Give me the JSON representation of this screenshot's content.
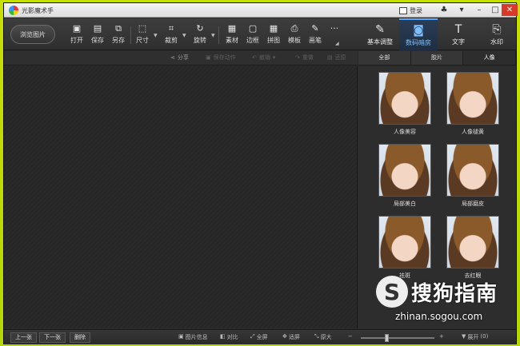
{
  "window": {
    "title": "光影魔术手"
  },
  "titlebar": {
    "login_label": "登录",
    "buttons": [
      "skin-icon",
      "menu-icon",
      "minimize-icon",
      "maximize-icon",
      "close-icon"
    ],
    "minimize": "–",
    "maximize": "□",
    "close": "✕",
    "skin": "♣",
    "menu": "▾"
  },
  "toolbar": {
    "browse_label": "浏览图片",
    "tools": [
      {
        "label": "打开",
        "icon": "▣"
      },
      {
        "label": "保存",
        "icon": "▤"
      },
      {
        "label": "另存",
        "icon": "⧉"
      },
      {
        "label": "尺寸",
        "icon": "⬚"
      },
      {
        "label": "裁剪",
        "icon": "⌗"
      },
      {
        "label": "旋转",
        "icon": "↻"
      },
      {
        "label": "素材",
        "icon": "▦"
      },
      {
        "label": "边框",
        "icon": "▢"
      },
      {
        "label": "拼图",
        "icon": "▦"
      },
      {
        "label": "模板",
        "icon": "⎙"
      },
      {
        "label": "画笔",
        "icon": "✎"
      },
      {
        "label": "",
        "icon": "···"
      }
    ],
    "right_tabs": [
      {
        "label": "基本调整",
        "icon": "✎"
      },
      {
        "label": "数码暗房",
        "icon": "◙"
      },
      {
        "label": "文字",
        "icon": "T"
      },
      {
        "label": "水印",
        "icon": "⎘"
      }
    ],
    "active_tab": "数码暗房"
  },
  "subbar": {
    "share": "分享",
    "save_action": "保存动作",
    "undo": "撤销",
    "redo": "重做",
    "restore": "还原"
  },
  "panel": {
    "tabs": [
      "全部",
      "胶片",
      "人像"
    ],
    "active_tab": "人像",
    "effects": [
      "人像美容",
      "人像褪黄",
      "局部美白",
      "局部磨皮",
      "祛斑",
      "去红眼"
    ]
  },
  "statusbar": {
    "prev": "上一张",
    "next": "下一张",
    "delete": "删除",
    "info": "图片信息",
    "compare": "对比",
    "fullscreen": "全屏",
    "fit": "适屏",
    "original": "原大",
    "zoom_minus": "−",
    "zoom_plus": "+",
    "expand": "展开",
    "expand_count": "(0)",
    "zoom_level": 0.34
  },
  "watermark": {
    "brand": "搜狗指南",
    "logo_letter": "S",
    "url": "zhinan.sogou.com"
  }
}
